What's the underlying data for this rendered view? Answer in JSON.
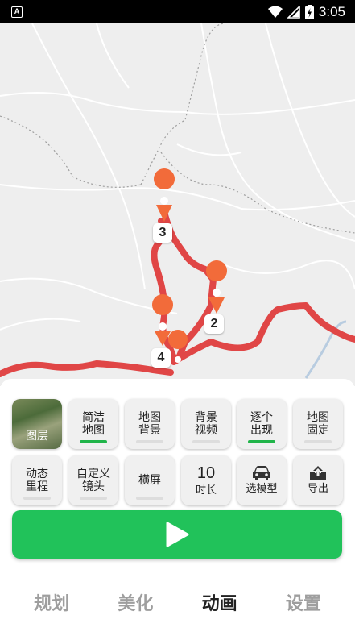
{
  "status_bar": {
    "time": "3:05",
    "notification_icon": "a-icon"
  },
  "map": {
    "route_color": "#e04646",
    "markers": [
      "3",
      "2",
      "4"
    ]
  },
  "controls": {
    "layer": {
      "label": "图层"
    },
    "row1": [
      {
        "label": "简洁\n地图",
        "enabled": true
      },
      {
        "label": "地图\n背景",
        "enabled": false
      },
      {
        "label": "背景\n视频",
        "enabled": false
      },
      {
        "label": "逐个\n出现",
        "enabled": true
      },
      {
        "label": "地图\n固定",
        "enabled": false
      }
    ],
    "row2": [
      {
        "label": "动态\n里程",
        "enabled": false
      },
      {
        "label": "自定义\n镜头",
        "enabled": false
      },
      {
        "label": "横屏",
        "enabled": false
      }
    ],
    "duration": {
      "value": "10",
      "label": "时长"
    },
    "model": {
      "label": "选模型",
      "icon": "car-icon"
    },
    "export": {
      "label": "导出",
      "icon": "upload-icon"
    },
    "play_color": "#21c25a"
  },
  "tabs": [
    {
      "label": "规划",
      "active": false
    },
    {
      "label": "美化",
      "active": false
    },
    {
      "label": "动画",
      "active": true
    },
    {
      "label": "设置",
      "active": false
    }
  ]
}
